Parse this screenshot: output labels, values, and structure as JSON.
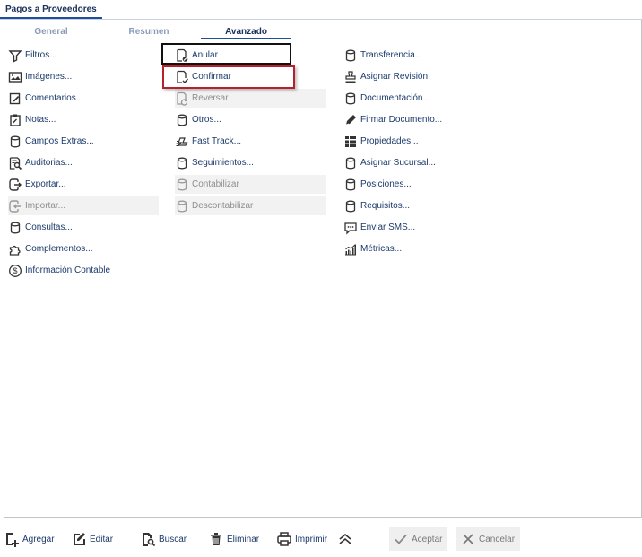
{
  "window": {
    "title": "Pagos a Proveedores"
  },
  "tabs": [
    {
      "label": "General"
    },
    {
      "label": "Resumen"
    },
    {
      "label": "Avanzado"
    }
  ],
  "columns": {
    "col1": [
      {
        "label": "Filtros...",
        "icon": "filter-icon",
        "disabled": false
      },
      {
        "label": "Imágenes...",
        "icon": "image-icon",
        "disabled": false
      },
      {
        "label": "Comentarios...",
        "icon": "comment-edit-icon",
        "disabled": false
      },
      {
        "label": "Notas...",
        "icon": "clipboard-icon",
        "disabled": false
      },
      {
        "label": "Campos Extras...",
        "icon": "database-icon",
        "disabled": false
      },
      {
        "label": "Auditorias...",
        "icon": "audit-icon",
        "disabled": false
      },
      {
        "label": "Exportar...",
        "icon": "export-icon",
        "disabled": false
      },
      {
        "label": "Importar...",
        "icon": "import-icon",
        "disabled": true
      },
      {
        "label": "Consultas...",
        "icon": "database-icon",
        "disabled": false
      },
      {
        "label": "Complementos...",
        "icon": "puzzle-icon",
        "disabled": false
      },
      {
        "label": "Información Contable",
        "icon": "dollar-icon",
        "disabled": false
      }
    ],
    "col2": [
      {
        "label": "Anular",
        "icon": "document-cancel-icon",
        "disabled": false
      },
      {
        "label": "Confirmar",
        "icon": "document-check-icon",
        "disabled": false
      },
      {
        "label": "Reversar",
        "icon": "document-revert-icon",
        "disabled": true
      },
      {
        "label": "Otros...",
        "icon": "database-icon",
        "disabled": false
      },
      {
        "label": "Fast Track...",
        "icon": "fast-track-icon",
        "disabled": false
      },
      {
        "label": "Seguimientos...",
        "icon": "database-icon",
        "disabled": false
      },
      {
        "label": "Contabilizar",
        "icon": "database-icon",
        "disabled": true
      },
      {
        "label": "Descontabilizar",
        "icon": "database-icon",
        "disabled": true
      }
    ],
    "col3": [
      {
        "label": "Transferencia...",
        "icon": "database-icon",
        "disabled": false
      },
      {
        "label": "Asignar Revisión",
        "icon": "stamp-icon",
        "disabled": false
      },
      {
        "label": "Documentación...",
        "icon": "database-icon",
        "disabled": false
      },
      {
        "label": "Firmar Documento...",
        "icon": "pen-icon",
        "disabled": false
      },
      {
        "label": "Propiedades...",
        "icon": "properties-icon",
        "disabled": false
      },
      {
        "label": "Asignar Sucursal...",
        "icon": "database-icon",
        "disabled": false
      },
      {
        "label": "Posiciones...",
        "icon": "database-icon",
        "disabled": false
      },
      {
        "label": "Requisitos...",
        "icon": "database-icon",
        "disabled": false
      },
      {
        "label": "Enviar SMS...",
        "icon": "sms-icon",
        "disabled": false
      },
      {
        "label": "Métricas...",
        "icon": "metrics-icon",
        "disabled": false
      }
    ]
  },
  "footer": {
    "add": "Agregar",
    "edit": "Editar",
    "search": "Buscar",
    "delete": "Eliminar",
    "print": "Imprimir",
    "accept": "Aceptar",
    "cancel": "Cancelar"
  },
  "colors": {
    "text": "#1a3a6b",
    "tab_active_underline": "#1f4e9c",
    "disabled_bg": "#f2f2f2",
    "highlight_red": "#b7212c",
    "highlight_black": "#111111"
  }
}
